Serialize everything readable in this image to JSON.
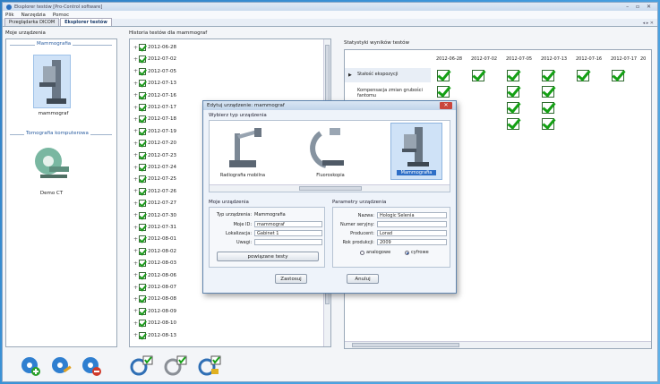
{
  "window": {
    "title": "Eksplorer testów [Pro-Control software]",
    "controls": "– ▫ ✕"
  },
  "menu": [
    "Plik",
    "Narzędzia",
    "Pomoc"
  ],
  "tabs": [
    {
      "label": "Przeglądarka DICOM",
      "active": false
    },
    {
      "label": "Eksplorer testów",
      "active": true
    }
  ],
  "tab_controls": "◂ ▸ ✕",
  "devices": {
    "title": "Moje urządzenia",
    "groups": [
      {
        "label": "Mammografia",
        "device": "mammograf"
      },
      {
        "label": "Tomografia komputerowa",
        "device": "Demo CT"
      }
    ]
  },
  "history": {
    "title": "Historia testów dla mammograf",
    "dates": [
      "2012-06-28",
      "2012-07-02",
      "2012-07-05",
      "2012-07-13",
      "2012-07-16",
      "2012-07-17",
      "2012-07-18",
      "2012-07-19",
      "2012-07-20",
      "2012-07-23",
      "2012-07-24",
      "2012-07-25",
      "2012-07-26",
      "2012-07-27",
      "2012-07-30",
      "2012-07-31",
      "2012-08-01",
      "2012-08-02",
      "2012-08-03",
      "2012-08-06",
      "2012-08-07",
      "2012-08-08",
      "2012-08-09",
      "2012-08-10",
      "2012-08-13"
    ]
  },
  "stats": {
    "title": "Statystyki wyników testów",
    "columns": [
      "2012-06-28",
      "2012-07-02",
      "2012-07-05",
      "2012-07-13",
      "2012-07-16",
      "2012-07-17",
      "20"
    ],
    "rows": [
      {
        "label": "Stałość ekspozycji",
        "checks": [
          true,
          true,
          true,
          true,
          true,
          true,
          false
        ]
      },
      {
        "label": "Kompensacja zmian grubości fantomu",
        "checks": [
          true,
          false,
          true,
          true,
          false,
          false,
          false
        ]
      },
      {
        "label": "",
        "checks": [
          false,
          false,
          true,
          true,
          false,
          false,
          false
        ]
      },
      {
        "label": "",
        "checks": [
          false,
          false,
          true,
          true,
          false,
          false,
          false
        ]
      }
    ]
  },
  "dialog": {
    "title": "Edytuj urządzenie: mammograf",
    "close": "✕",
    "type_legend": "Wybierz typ urządzenia",
    "types": [
      "Radiografia mobilna",
      "Fluoroskopia",
      "Mammografia"
    ],
    "my_device_legend": "Moje urządzenia",
    "fields_left": [
      {
        "label": "Typ urządzenia:",
        "value": "Mammografia",
        "is_input": false
      },
      {
        "label": "Moje ID:",
        "value": "mammograf",
        "is_input": true
      },
      {
        "label": "Lokalizacja:",
        "value": "Gabinet 1",
        "is_input": true
      },
      {
        "label": "Uwagi:",
        "value": "",
        "is_input": true
      }
    ],
    "related_button": "powiązane testy",
    "params_legend": "Parametry urządzenia",
    "fields_right": [
      {
        "label": "Nazwa:",
        "value": "Hologic Selenia"
      },
      {
        "label": "Numer seryjny:",
        "value": ""
      },
      {
        "label": "Producent:",
        "value": "Lorad"
      },
      {
        "label": "Rok produkcji:",
        "value": "2009"
      }
    ],
    "radio": [
      {
        "label": "analogowe",
        "selected": false
      },
      {
        "label": "cyfrowe",
        "selected": true
      }
    ],
    "apply": "Zastosuj",
    "cancel": "Anuluj"
  },
  "colors": {
    "accent": "#2a5da0",
    "check": "#14a014",
    "selected_bg": "#cfe2f7"
  }
}
